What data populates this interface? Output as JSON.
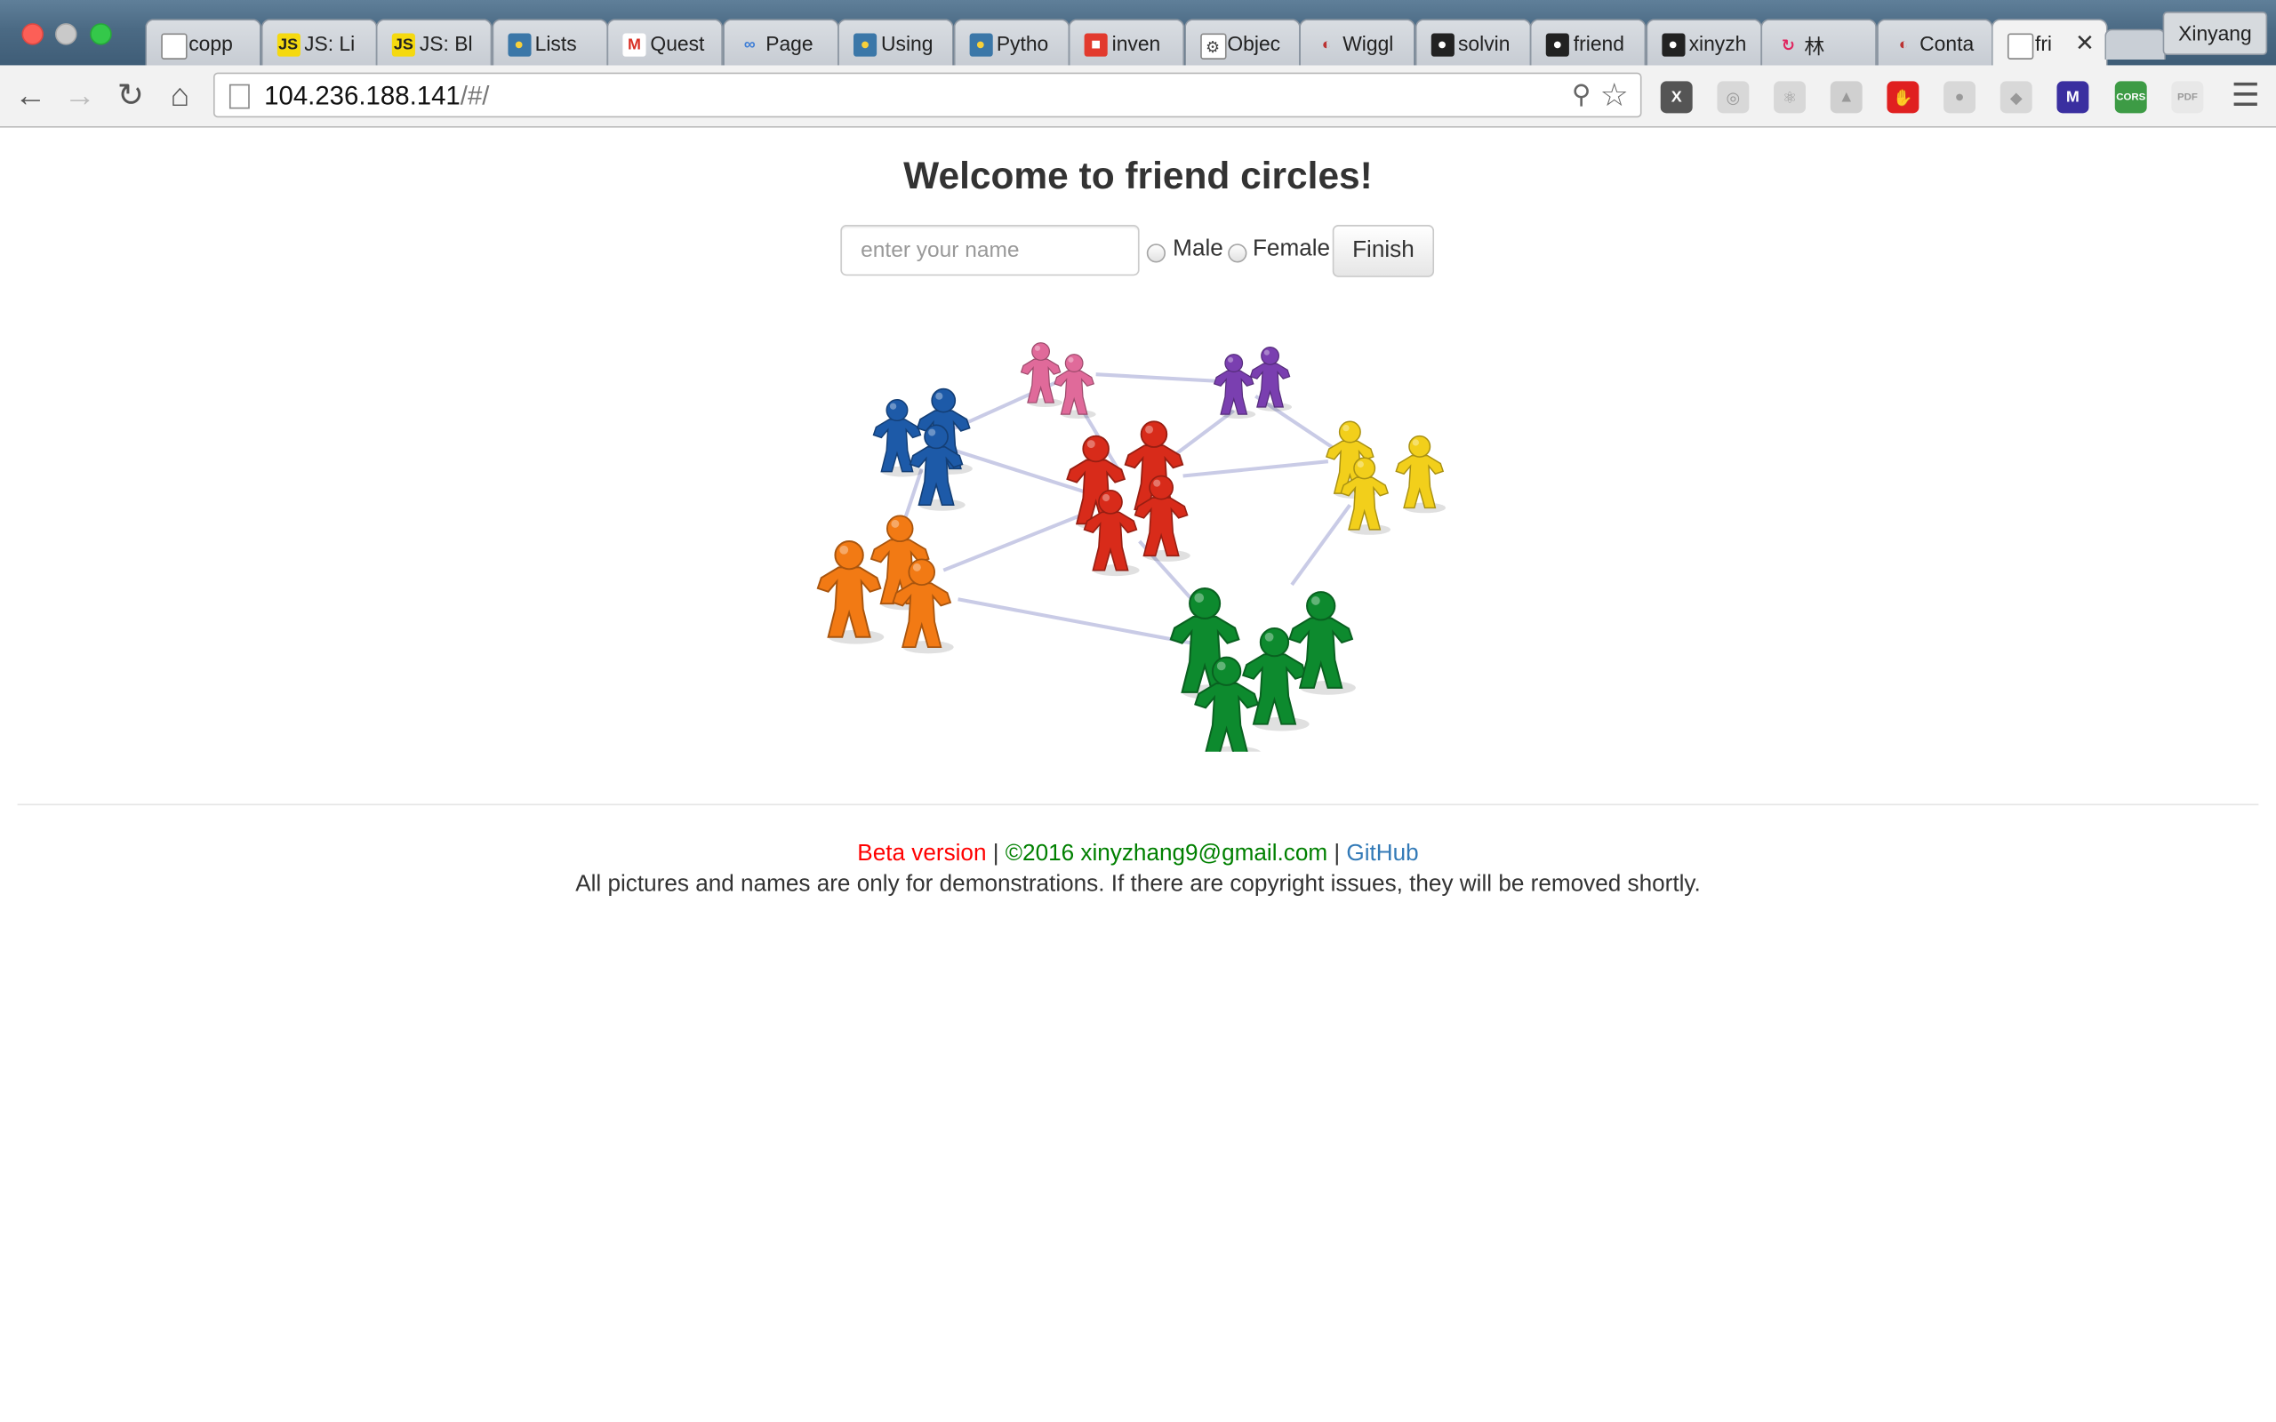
{
  "browser": {
    "tabs": [
      {
        "label": "copp",
        "icon": "page-icon"
      },
      {
        "label": "JS: Li",
        "icon": "js-icon"
      },
      {
        "label": "JS: Bl",
        "icon": "js-icon"
      },
      {
        "label": "Lists",
        "icon": "python-icon"
      },
      {
        "label": "Quest",
        "icon": "gmail-icon"
      },
      {
        "label": "Page",
        "icon": "infinity-icon"
      },
      {
        "label": "Using",
        "icon": "python-icon"
      },
      {
        "label": "Pytho",
        "icon": "python-icon"
      },
      {
        "label": "inven",
        "icon": "squares-icon"
      },
      {
        "label": "Objec",
        "icon": "doc-icon"
      },
      {
        "label": "Wiggl",
        "icon": "wiggle-icon"
      },
      {
        "label": "solvin",
        "icon": "github-icon"
      },
      {
        "label": "friend",
        "icon": "github-icon"
      },
      {
        "label": "xinyzh",
        "icon": "github-icon"
      },
      {
        "label": "林",
        "icon": "refresh-icon"
      },
      {
        "label": "Conta",
        "icon": "wiggle-icon"
      },
      {
        "label": "fri",
        "icon": "page-icon",
        "active": true
      }
    ],
    "profile_name": "Xinyang",
    "url_host": "104.236.188.141",
    "url_path": "/#/",
    "extensions": [
      "x-extension",
      "circle-extension",
      "react-extension",
      "drive-extension",
      "adblock-extension",
      "grey-extension",
      "dropbox-extension",
      "m-extension",
      "cors-extension",
      "pdf-extension"
    ]
  },
  "page": {
    "title": "Welcome to friend circles!",
    "name_placeholder": "enter your name",
    "male_label": "Male",
    "female_label": "Female",
    "finish_label": "Finish",
    "footer": {
      "beta": "Beta version",
      "sep1": " | ",
      "copyright": "©2016 xinyzhang9@gmail.com",
      "sep2": " | ",
      "github": "GitHub",
      "disclaimer": "All pictures and names are only for demonstrations. If there are copyright issues, they will be removed shortly."
    }
  },
  "colors": {
    "beta": "#ff0000",
    "copyright": "#008000",
    "link": "#337ab7",
    "people": [
      "#1d5aa8",
      "#e06a9a",
      "#7a3fb0",
      "#f2cf1b",
      "#d82b1a",
      "#f27a14",
      "#0d8a2e"
    ]
  }
}
